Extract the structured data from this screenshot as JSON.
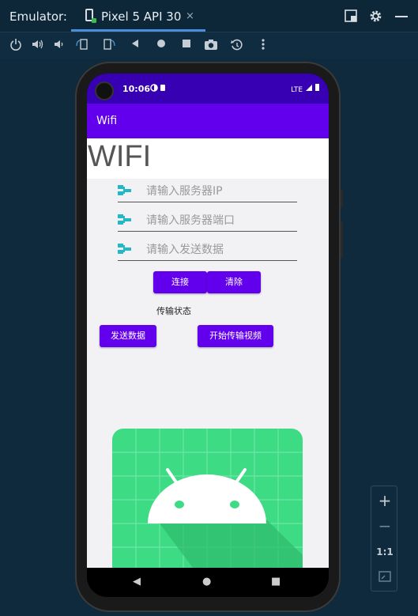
{
  "window": {
    "title": "Emulator:",
    "tab_label": "Pixel 5 API 30",
    "tab_close": "×"
  },
  "toolbar": {
    "icons": [
      "power-icon",
      "volume-up-icon",
      "volume-down-icon",
      "rotate-left-icon",
      "rotate-right-icon",
      "back-icon",
      "home-icon",
      "overview-icon",
      "camera-icon",
      "replay-icon",
      "more-icon"
    ]
  },
  "device": {
    "status": {
      "time": "10:06",
      "network": "LTE"
    },
    "app_title": "Wifi",
    "heading": "WIFI",
    "fields": [
      {
        "placeholder": "请输入服务器IP",
        "value": ""
      },
      {
        "placeholder": "请输入服务器端口",
        "value": ""
      },
      {
        "placeholder": "请输入发送数据",
        "value": ""
      }
    ],
    "buttons": {
      "connect": "连接",
      "clear": "清除",
      "send": "发送数据",
      "video": "开始传输视频"
    },
    "status_text": "传输状态",
    "nav": {
      "back": "◀",
      "home": "●",
      "recents": "■"
    }
  },
  "zoom": {
    "zoom_in": "+",
    "zoom_out": "−",
    "one_to_one": "1:1"
  },
  "colors": {
    "primary": "#6200ee",
    "primary_dark": "#3700b3",
    "android_green": "#3ddc84",
    "ide_bg": "#0f2a3c"
  }
}
